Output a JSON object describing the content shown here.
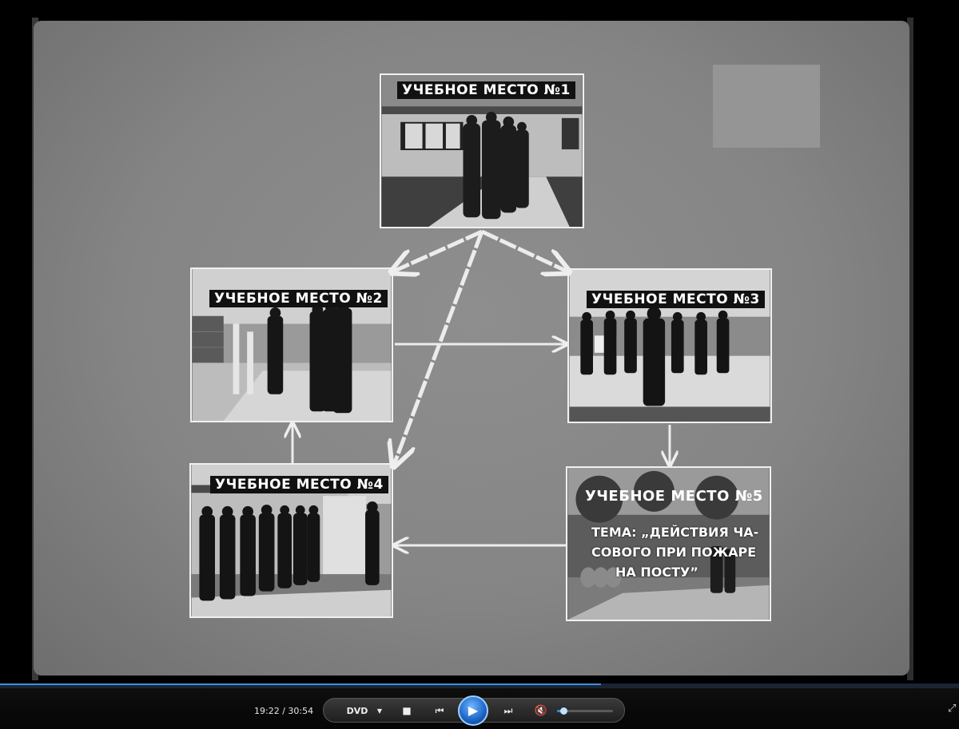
{
  "slide": {
    "stations": [
      {
        "label": "Учебное место №1"
      },
      {
        "label": "Учебное место №2"
      },
      {
        "label": "Учебное место №3"
      },
      {
        "label": "Учебное место №4"
      },
      {
        "label": "Учебное место №5",
        "topic_lines": [
          "Тема: „Действия ча-",
          "сового при пожаре",
          "на посту”"
        ]
      }
    ]
  },
  "player": {
    "current_time": "19:22",
    "separator": "/",
    "total_time": "30:54",
    "progress_fraction": 0.627,
    "volume_fraction": 0.12,
    "mode_label": "DVD",
    "icons": {
      "mode_dropdown": "chevron-down-icon",
      "stop": "stop-icon",
      "previous": "previous-chapter-icon",
      "play": "play-icon",
      "next": "next-chapter-icon",
      "mute": "mute-icon",
      "fullscreen": "fullscreen-icon"
    },
    "accent_color": "#3d8fe0"
  }
}
